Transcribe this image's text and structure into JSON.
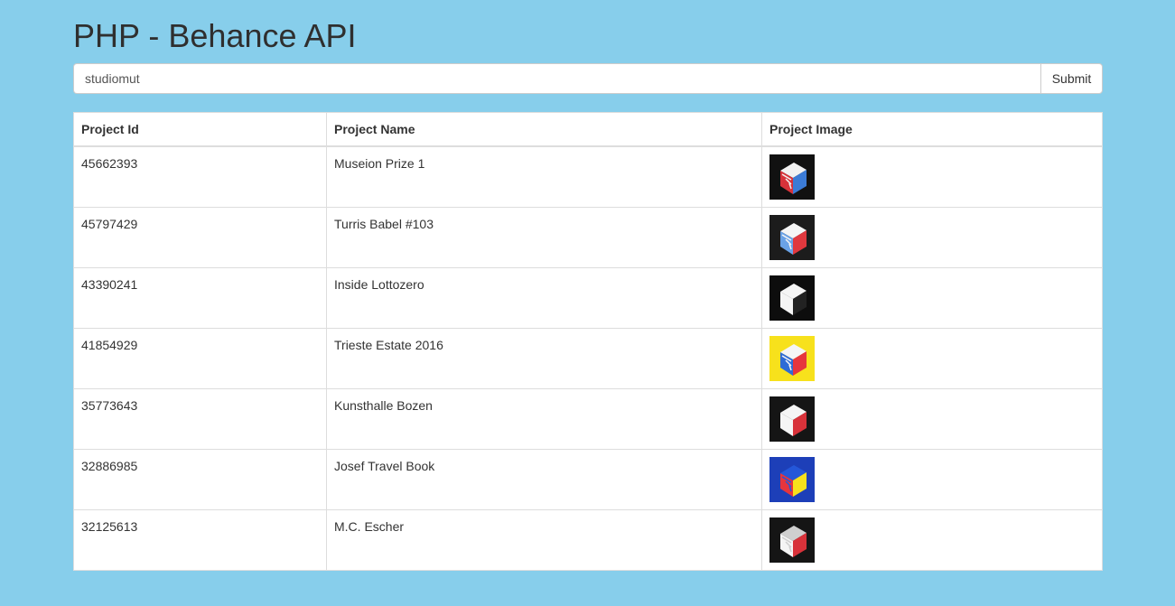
{
  "page": {
    "title": "PHP - Behance API"
  },
  "search": {
    "value": "studiomut",
    "submit_label": "Submit"
  },
  "table": {
    "headers": {
      "id": "Project Id",
      "name": "Project Name",
      "image": "Project Image"
    },
    "rows": [
      {
        "id": "45662393",
        "name": "Museion Prize 1",
        "thumb_colors": [
          "#111111",
          "#d8323a",
          "#3b7bd6",
          "#f2f2f2"
        ]
      },
      {
        "id": "45797429",
        "name": "Turris Babel #103",
        "thumb_colors": [
          "#1c1c1c",
          "#6aa2e6",
          "#e0383e",
          "#f5f5f5"
        ]
      },
      {
        "id": "43390241",
        "name": "Inside Lottozero",
        "thumb_colors": [
          "#0d0d0d",
          "#f5f5f5",
          "#222222",
          "#f5f5f5"
        ]
      },
      {
        "id": "41854929",
        "name": "Trieste Estate 2016",
        "thumb_colors": [
          "#f7e11c",
          "#2e6bd6",
          "#e6353d",
          "#f5f5f5"
        ]
      },
      {
        "id": "35773643",
        "name": "Kunsthalle Bozen",
        "thumb_colors": [
          "#151515",
          "#f5f5f5",
          "#d8323a",
          "#f5f5f5"
        ]
      },
      {
        "id": "32886985",
        "name": "Josef Travel Book",
        "thumb_colors": [
          "#1d3fb8",
          "#e6353d",
          "#f7e11c",
          "#2457d9"
        ]
      },
      {
        "id": "32125613",
        "name": "M.C. Escher",
        "thumb_colors": [
          "#151515",
          "#f5f5f5",
          "#d8323a",
          "#cfcfcf"
        ]
      }
    ]
  }
}
